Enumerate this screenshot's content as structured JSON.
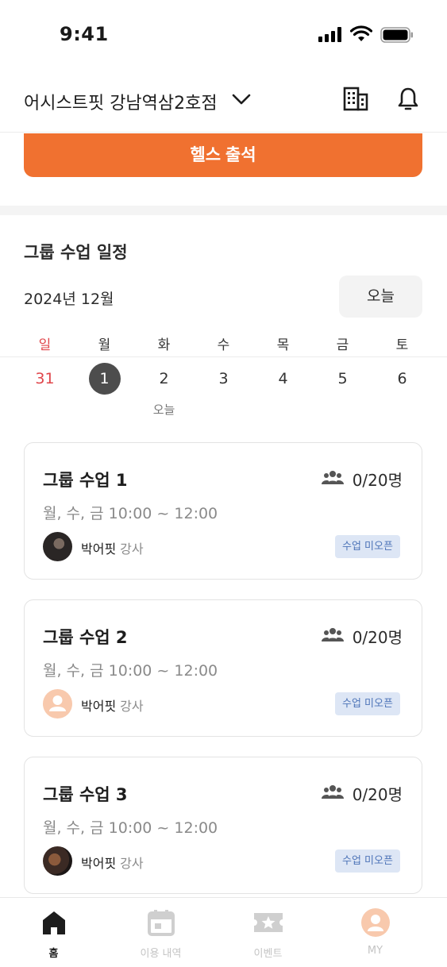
{
  "status_bar": {
    "time": "9:41"
  },
  "header": {
    "branch": "어시스트핏 강남역삼2호점"
  },
  "checkin": {
    "label": "헬스 출석"
  },
  "schedule_section": {
    "title": "그룹 수업 일정",
    "month": "2024년 12월",
    "today_button": "오늘",
    "today_caption": "오늘",
    "weekdays": [
      "일",
      "월",
      "화",
      "수",
      "목",
      "금",
      "토"
    ],
    "dates": [
      "31",
      "1",
      "2",
      "3",
      "4",
      "5",
      "6"
    ],
    "selected_date": "1"
  },
  "classes": [
    {
      "title": "그룹 수업 1",
      "capacity": "0/20명",
      "schedule": "월, 수, 금 10:00 ~ 12:00",
      "instructor": "박어핏",
      "role": "강사",
      "status": "수업 미오픈",
      "avatar": "photo"
    },
    {
      "title": "그룹 수업 2",
      "capacity": "0/20명",
      "schedule": "월, 수, 금 10:00 ~ 12:00",
      "instructor": "박어핏",
      "role": "강사",
      "status": "수업 미오픈",
      "avatar": "placeholder"
    },
    {
      "title": "그룹 수업 3",
      "capacity": "0/20명",
      "schedule": "월, 수, 금 10:00 ~ 12:00",
      "instructor": "박어핏",
      "role": "강사",
      "status": "수업 미오픈",
      "avatar": "photo"
    }
  ],
  "tab_bar": {
    "tabs": [
      {
        "label": "홈",
        "icon": "home-icon",
        "active": true
      },
      {
        "label": "이용 내역",
        "icon": "calendar-icon",
        "active": false
      },
      {
        "label": "이벤트",
        "icon": "ticket-star-icon",
        "active": false
      },
      {
        "label": "MY",
        "icon": "profile-icon",
        "active": false
      }
    ]
  },
  "colors": {
    "accent": "#f07130",
    "sunday": "#e0464b",
    "badge_bg": "#dde6f5",
    "badge_text": "#4d74b8"
  }
}
